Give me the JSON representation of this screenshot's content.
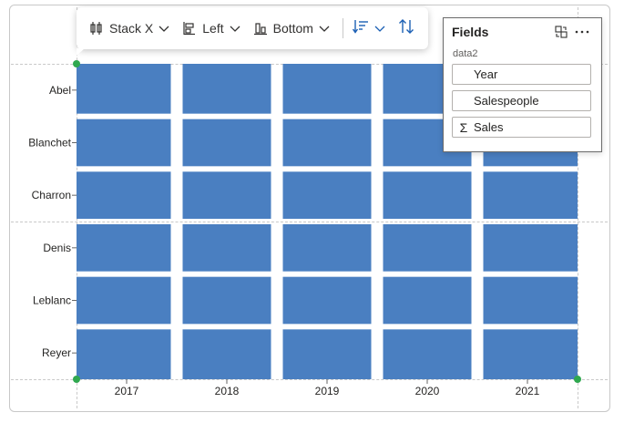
{
  "toolbar": {
    "stack_label": "Stack X",
    "align_label": "Left",
    "position_label": "Bottom"
  },
  "fields_panel": {
    "title": "Fields",
    "dataset": "data2",
    "items": [
      {
        "label": "Year",
        "icon": ""
      },
      {
        "label": "Salespeople",
        "icon": ""
      },
      {
        "label": "Sales",
        "icon": "Σ"
      }
    ]
  },
  "chart_data": {
    "type": "heatmap",
    "x": [
      "2017",
      "2018",
      "2019",
      "2020",
      "2021"
    ],
    "y": [
      "Abel",
      "Blanchet",
      "Charron",
      "Denis",
      "Leblanc",
      "Reyer"
    ],
    "cell_color": "#4a7fc1",
    "grid": false,
    "legend": "none"
  }
}
